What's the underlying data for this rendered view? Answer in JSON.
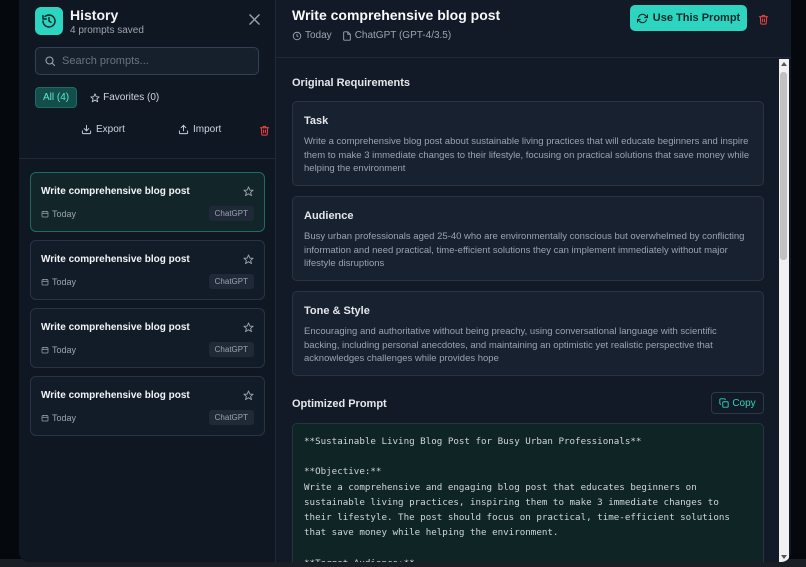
{
  "sidebar": {
    "title": "History",
    "subtitle": "4 prompts saved",
    "search_placeholder": "Search prompts...",
    "filters": {
      "all_label": "All (4)",
      "favorites_label": "Favorites (0)"
    },
    "actions": {
      "export_label": "Export",
      "import_label": "Import"
    },
    "cards": [
      {
        "title": "Write comprehensive blog post",
        "date": "Today",
        "tag": "ChatGPT",
        "selected": true
      },
      {
        "title": "Write comprehensive blog post",
        "date": "Today",
        "tag": "ChatGPT",
        "selected": false
      },
      {
        "title": "Write comprehensive blog post",
        "date": "Today",
        "tag": "ChatGPT",
        "selected": false
      },
      {
        "title": "Write comprehensive blog post",
        "date": "Today",
        "tag": "ChatGPT",
        "selected": false
      }
    ]
  },
  "main": {
    "title": "Write comprehensive blog post",
    "meta_date": "Today",
    "meta_model": "ChatGPT (GPT-4/3.5)",
    "use_button": "Use This Prompt",
    "original_heading": "Original Requirements",
    "task_title": "Task",
    "task_text": "Write a comprehensive blog post about sustainable living practices that will educate beginners and inspire them to make 3 immediate changes to their lifestyle, focusing on practical solutions that save money while helping the environment",
    "audience_title": "Audience",
    "audience_text": "Busy urban professionals aged 25-40 who are environmentally conscious but overwhelmed by conflicting information and need practical, time-efficient solutions they can implement immediately without major lifestyle disruptions",
    "tone_title": "Tone & Style",
    "tone_text": "Encouraging and authoritative without being preachy, using conversational language with scientific backing, including personal anecdotes, and maintaining an optimistic yet realistic perspective that acknowledges challenges while provides hope",
    "optimized_heading": "Optimized Prompt",
    "copy_label": "Copy",
    "code_text": "**Sustainable Living Blog Post for Busy Urban Professionals**\n\n**Objective:**\nWrite a comprehensive and engaging blog post that educates beginners on sustainable living practices, inspiring them to make 3 immediate changes to their lifestyle. The post should focus on practical, time-efficient solutions that save money while helping the environment.\n\n**Target Audience:**"
  },
  "colors": {
    "accent": "#2dd4bf",
    "danger": "#ef4444",
    "background": "#111a26"
  }
}
